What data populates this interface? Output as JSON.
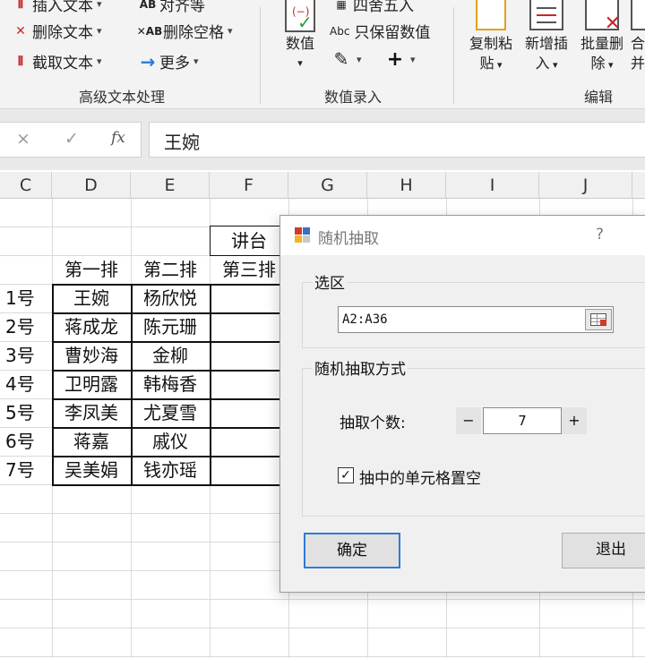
{
  "ribbon": {
    "left_items": [
      {
        "icon": "insert-text-icon",
        "glyph": "⫴",
        "label": "插入文本"
      },
      {
        "icon": "delete-text-icon",
        "glyph": "✕",
        "label": "删除文本"
      },
      {
        "icon": "extract-text-icon",
        "glyph": "⫴",
        "label": "截取文本"
      }
    ],
    "mid_items": [
      {
        "icon": "align-icon",
        "glyph": "AB",
        "label": "对齐等"
      },
      {
        "icon": "delete-spaces-icon",
        "glyph": "✕AB",
        "label": "删除空格"
      },
      {
        "icon": "more-arrow-icon",
        "glyph": "→",
        "label": "更多"
      }
    ],
    "group1_label": "高级文本处理",
    "value_btn_label": "数值",
    "round_label": "四舍五入",
    "keep_numbers_label": "只保留数值",
    "keep_numbers_prefix": "Abc",
    "group2_label": "数值录入",
    "copy_paste_label_1": "复制粘",
    "copy_paste_label_2": "贴",
    "new_insert_label_1": "新增插",
    "new_insert_label_2": "入",
    "batch_delete_label_1": "批量删",
    "batch_delete_label_2": "除",
    "merge_label_1": "合",
    "merge_label_2": "并",
    "group3_label": "编辑"
  },
  "formula_bar": {
    "cancel_glyph": "×",
    "confirm_glyph": "✓",
    "fx_glyph": "fx",
    "value": "王婉"
  },
  "columns": [
    "C",
    "D",
    "E",
    "F",
    "G",
    "H",
    "I",
    "J"
  ],
  "sheet": {
    "podium": "讲台",
    "row_headers": [
      "第一排",
      "第二排",
      "第三排"
    ],
    "rows": [
      {
        "label": "1号",
        "c1": "王婉",
        "c2": "杨欣悦"
      },
      {
        "label": "2号",
        "c1": "蒋成龙",
        "c2": "陈元珊"
      },
      {
        "label": "3号",
        "c1": "曹妙海",
        "c2": "金柳"
      },
      {
        "label": "4号",
        "c1": "卫明露",
        "c2": "韩梅香"
      },
      {
        "label": "5号",
        "c1": "李凤美",
        "c2": "尤夏雪"
      },
      {
        "label": "6号",
        "c1": "蒋嘉",
        "c2": "戚仪"
      },
      {
        "label": "7号",
        "c1": "吴美娟",
        "c2": "钱亦瑶"
      }
    ]
  },
  "dialog": {
    "title": "随机抽取",
    "help": "?",
    "selection_group": "选区",
    "range_value": "A2:A36",
    "mode_group": "随机抽取方式",
    "count_label": "抽取个数:",
    "minus": "−",
    "count_value": "7",
    "plus": "+",
    "clear_checkbox_label": "抽中的单元格置空",
    "checked": "✓",
    "ok_label": "确定",
    "exit_label": "退出"
  }
}
